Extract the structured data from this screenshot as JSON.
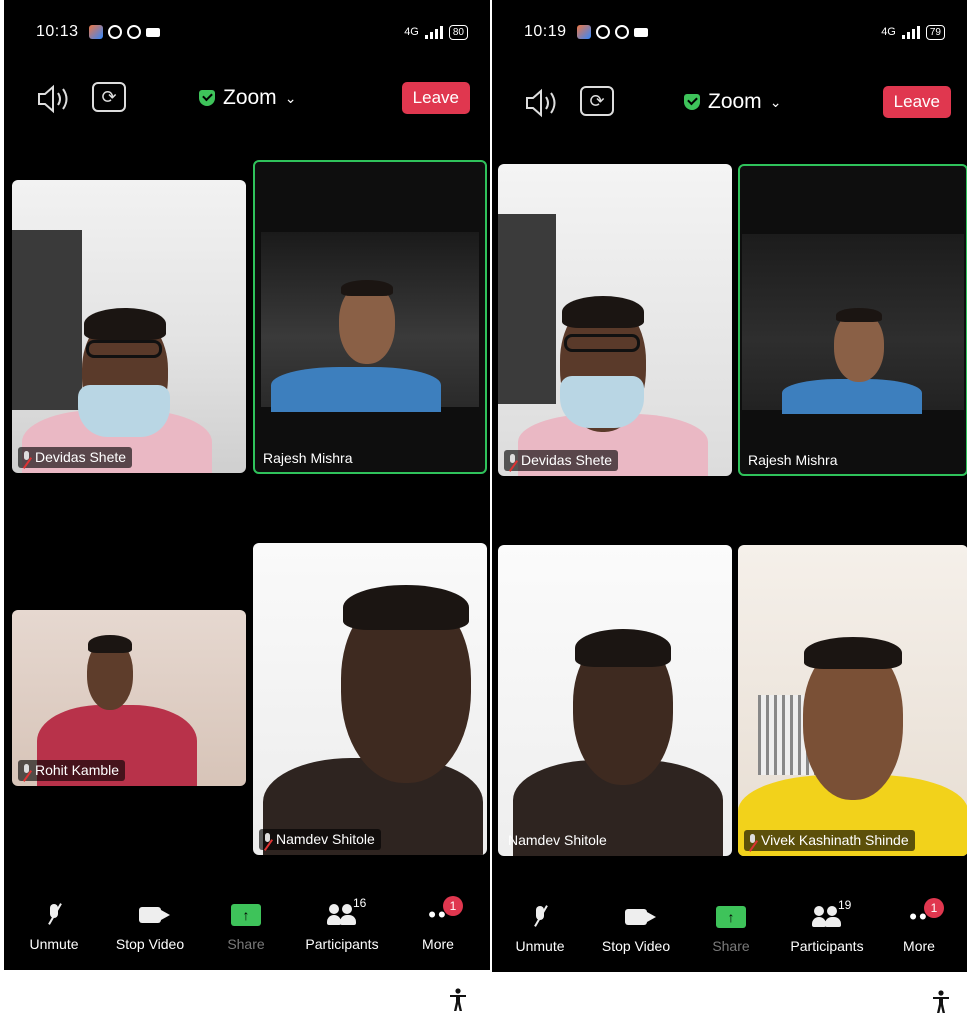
{
  "screens": [
    {
      "status": {
        "time": "10:13",
        "network": "4G",
        "battery": "80"
      },
      "topbar": {
        "meeting_title": "Zoom",
        "leave_label": "Leave"
      },
      "tiles": [
        {
          "name": "Devidas Shete",
          "muted": true,
          "active": false
        },
        {
          "name": "Rajesh Mishra",
          "muted": false,
          "active": true
        },
        {
          "name": "Rohit Kamble",
          "muted": true,
          "active": false
        },
        {
          "name": "Namdev Shitole",
          "muted": true,
          "active": false
        }
      ],
      "controls": {
        "unmute": "Unmute",
        "stop_video": "Stop Video",
        "share": "Share",
        "participants": "Participants",
        "participants_count": "16",
        "more": "More",
        "more_badge": "1"
      }
    },
    {
      "status": {
        "time": "10:19",
        "network": "4G",
        "battery": "79"
      },
      "topbar": {
        "meeting_title": "Zoom",
        "leave_label": "Leave"
      },
      "tiles": [
        {
          "name": "Devidas Shete",
          "muted": true,
          "active": false
        },
        {
          "name": "Rajesh Mishra",
          "muted": false,
          "active": true
        },
        {
          "name": "Namdev Shitole",
          "muted": false,
          "active": false
        },
        {
          "name": "Vivek Kashinath Shinde",
          "muted": true,
          "active": false
        }
      ],
      "controls": {
        "unmute": "Unmute",
        "stop_video": "Stop Video",
        "share": "Share",
        "participants": "Participants",
        "participants_count": "19",
        "more": "More",
        "more_badge": "1"
      }
    }
  ],
  "colors": {
    "accent_green": "#3ec35a",
    "leave_red": "#e0374f",
    "background": "#000000"
  },
  "icons": [
    "speaker-icon",
    "camera-flip-icon",
    "shield-check-icon",
    "chevron-down-icon",
    "mic-muted-icon",
    "video-camera-icon",
    "share-arrow-icon",
    "participants-icon",
    "more-dots-icon",
    "accessibility-icon"
  ]
}
